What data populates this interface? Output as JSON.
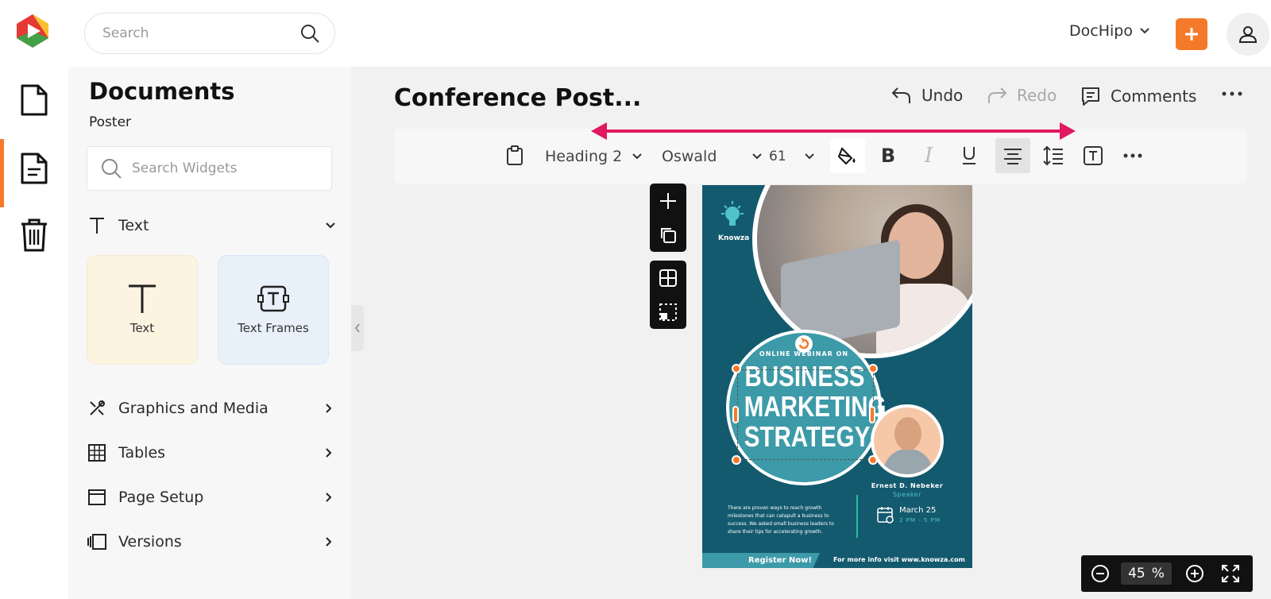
{
  "app": {
    "name": "DocHipo"
  },
  "header": {
    "search_placeholder": "Search",
    "account_label": "DocHipo"
  },
  "rail": {
    "items": [
      "documents",
      "templates",
      "trash"
    ]
  },
  "panel": {
    "title": "Documents",
    "subtitle": "Poster",
    "widget_search_placeholder": "Search Widgets",
    "sections": {
      "text": "Text",
      "graphics": "Graphics and Media",
      "tables": "Tables",
      "page_setup": "Page Setup",
      "versions": "Versions"
    },
    "cards": {
      "text": "Text",
      "text_frames": "Text Frames"
    }
  },
  "editor": {
    "doc_title": "Conference Post...",
    "undo": "Undo",
    "redo": "Redo",
    "comments": "Comments"
  },
  "toolbar": {
    "style": "Heading 2",
    "font": "Oswald",
    "size": "61"
  },
  "poster": {
    "brand": "Knowza",
    "webinar_label": "ONLINE WEBINAR ON",
    "headline_1": "BUSINESS",
    "headline_2": "MARKETING",
    "headline_3": "STRATEGY",
    "speaker_name": "Ernest D. Nebeker",
    "speaker_role": "Speaker",
    "body": "There are proven ways to reach growth milestones that can catapult a business to success. We asked small business leaders to share their tips for accelerating growth.",
    "date": "March 25",
    "time": "2 PM - 5 PM",
    "register": "Register Now!",
    "more_info": "For more info visit www.knowza.com"
  },
  "zoom": {
    "value": "45",
    "unit": "%"
  },
  "colors": {
    "accent": "#f47a2a",
    "annotation_arrow": "#e0185e",
    "poster_bg": "#145a6e",
    "poster_teal": "#3d9aa8"
  }
}
